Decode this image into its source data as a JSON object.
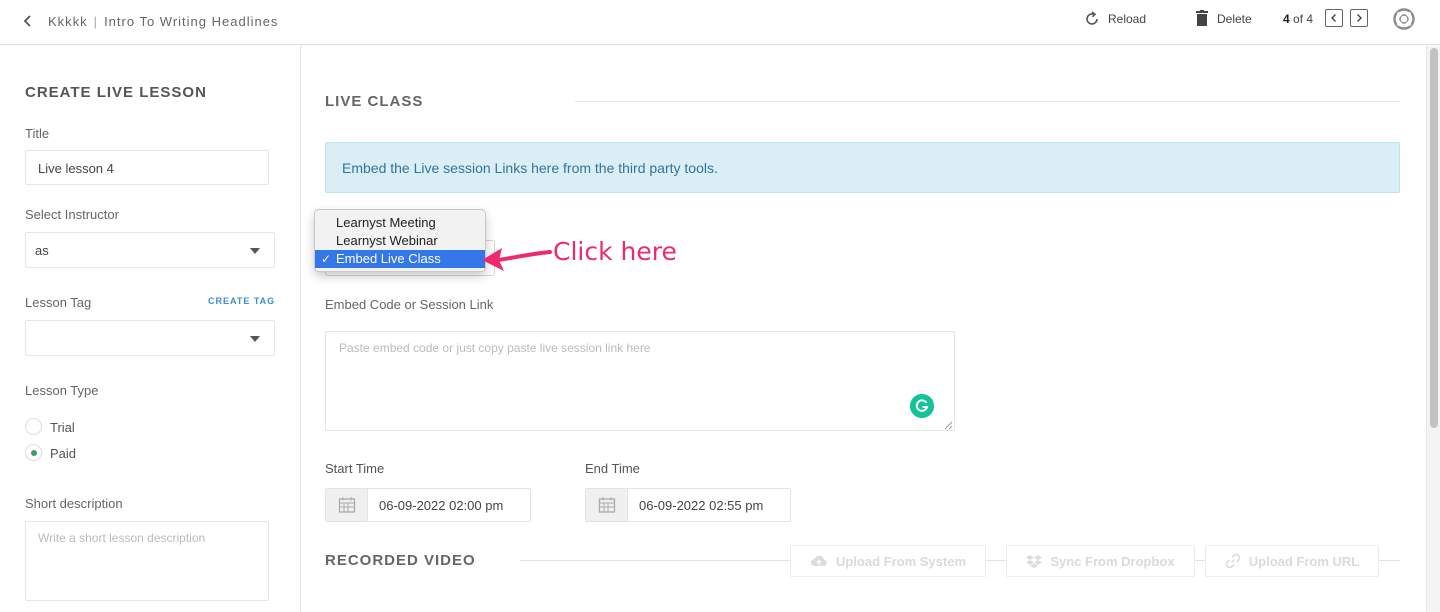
{
  "header": {
    "course": "Kkkkk",
    "separator": "|",
    "lesson": "Intro To Writing Headlines",
    "reload_label": "Reload",
    "delete_label": "Delete",
    "pager_current": "4",
    "pager_total": "of 4"
  },
  "sidebar": {
    "heading": "CREATE LIVE LESSON",
    "title_label": "Title",
    "title_value": "Live lesson 4",
    "instructor_label": "Select Instructor",
    "instructor_value": "as",
    "tag_label": "Lesson Tag",
    "create_tag": "CREATE TAG",
    "tag_value": "",
    "type_label": "Lesson Type",
    "type_options": [
      "Trial",
      "Paid"
    ],
    "type_selected": "Paid",
    "short_desc_label": "Short description",
    "short_desc_placeholder": "Write a short lesson description"
  },
  "live_class": {
    "heading": "LIVE CLASS",
    "alert": "Embed the Live session Links here from the third party tools.",
    "dropdown_options": [
      "Learnyst Meeting",
      "Learnyst Webinar",
      "Embed Live Class"
    ],
    "dropdown_selected": "Embed Live Class",
    "check_mark": "✓",
    "annotation": "Click here",
    "embed_label": "Embed Code or Session Link",
    "embed_placeholder": "Paste embed code or just copy paste live session link here",
    "start_label": "Start Time",
    "start_value": "06-09-2022 02:00 pm",
    "end_label": "End Time",
    "end_value": "06-09-2022 02:55 pm"
  },
  "recorded": {
    "heading": "RECORDED VIDEO",
    "buttons": [
      "Upload From System",
      "Sync From Dropbox",
      "Upload From URL"
    ]
  },
  "colors": {
    "accent_link": "#3a8fd0",
    "radio_selected": "#3aa15c",
    "annotation": "#ee2a6f",
    "dropdown_highlight": "#3477e8",
    "alert_bg": "#d9eef5",
    "grammarly": "#15c39a"
  }
}
